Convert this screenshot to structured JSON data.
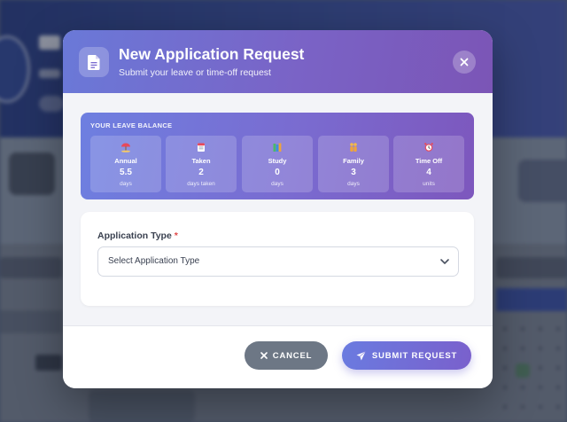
{
  "modal": {
    "title": "New Application Request",
    "subtitle": "Submit your leave or time-off request",
    "header_icon": "document-icon",
    "close_icon": "close-icon"
  },
  "balance": {
    "label": "YOUR LEAVE BALANCE",
    "items": [
      {
        "name": "Annual",
        "value": "5.5",
        "unit": "days",
        "icon": "beach-icon"
      },
      {
        "name": "Taken",
        "value": "2",
        "unit": "days taken",
        "icon": "calendar-icon"
      },
      {
        "name": "Study",
        "value": "0",
        "unit": "days",
        "icon": "books-icon"
      },
      {
        "name": "Family",
        "value": "3",
        "unit": "days",
        "icon": "family-icon"
      },
      {
        "name": "Time Off",
        "value": "4",
        "unit": "units",
        "icon": "alarm-clock-icon"
      }
    ]
  },
  "form": {
    "application_type_label": "Application Type",
    "required_marker": "*",
    "application_type_value": "Select Application Type"
  },
  "footer": {
    "cancel_label": "CANCEL",
    "submit_label": "SUBMIT REQUEST"
  },
  "colors": {
    "header_start": "#6a79d8",
    "header_end": "#7b55b6",
    "cancel_bg": "#6d7785",
    "required": "#e04848"
  }
}
